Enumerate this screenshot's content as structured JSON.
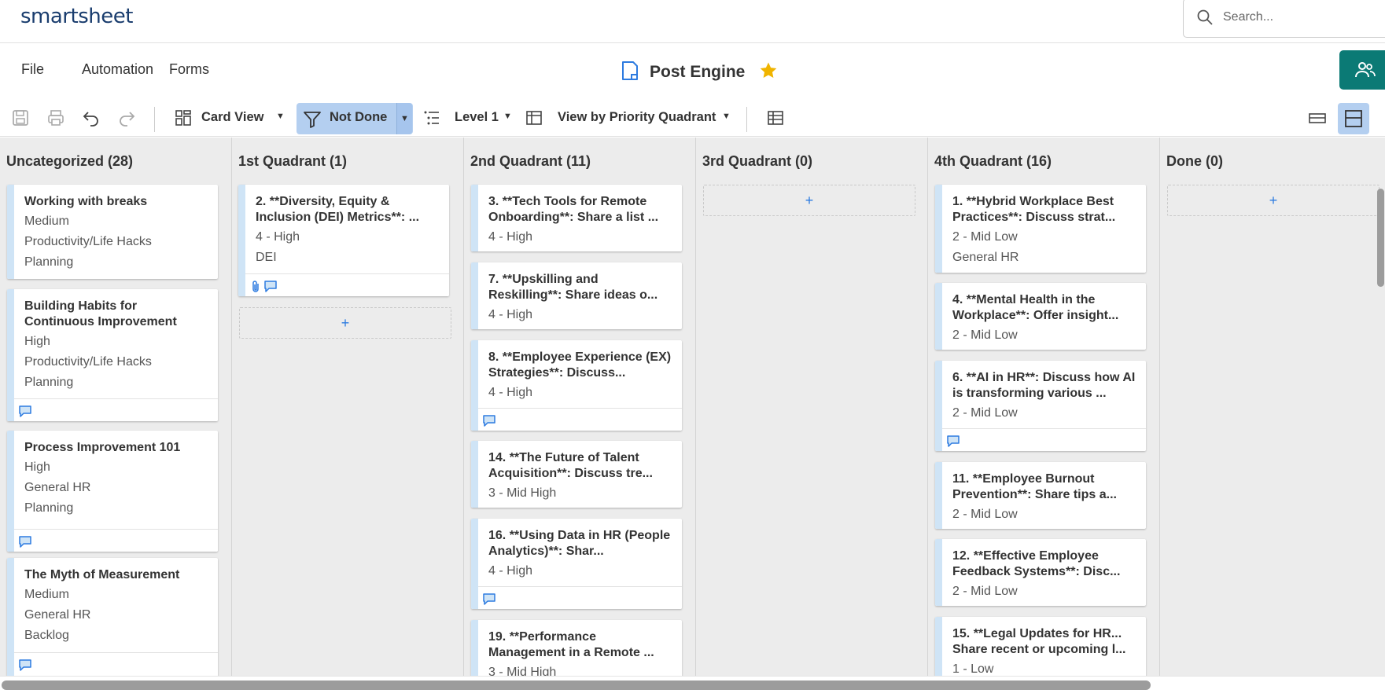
{
  "app": {
    "logo": "smartsheet"
  },
  "search": {
    "placeholder": "Search..."
  },
  "menu": {
    "file": "File",
    "automation": "Automation",
    "forms": "Forms"
  },
  "sheet": {
    "title": "Post Engine"
  },
  "toolbar": {
    "view_label": "Card View",
    "filter_label": "Not Done",
    "level_label": "Level 1",
    "view_by_label": "View by Priority Quadrant"
  },
  "lanes": [
    {
      "title": "Uncategorized (28)",
      "cards": [
        {
          "title": "Working with breaks",
          "fields": [
            "Medium",
            "Productivity/Life Hacks",
            "Planning"
          ]
        },
        {
          "title": "Building Habits for Continuous Improvement",
          "fields": [
            "High",
            "Productivity/Life Hacks",
            "Planning"
          ]
        },
        {
          "title": "Process Improvement 101",
          "fields": [
            "High",
            "General HR",
            "Planning"
          ]
        },
        {
          "title": "The Myth of Measurement",
          "fields": [
            "Medium",
            "General HR",
            "Backlog"
          ]
        }
      ]
    },
    {
      "title": "1st Quadrant (1)",
      "cards": [
        {
          "title": "2. **Diversity, Equity & Inclusion (DEI) Metrics**: ...",
          "fields": [
            "4 - High",
            "DEI"
          ]
        }
      ],
      "add": "+"
    },
    {
      "title": "2nd Quadrant (11)",
      "cards": [
        {
          "title": "3. **Tech Tools for Remote Onboarding**: Share a list ...",
          "fields": [
            "4 - High"
          ]
        },
        {
          "title": "7. **Upskilling and Reskilling**: Share ideas o...",
          "fields": [
            "4 - High"
          ]
        },
        {
          "title": "8. **Employee Experience (EX) Strategies**: Discuss...",
          "fields": [
            "4 - High"
          ]
        },
        {
          "title": "14. **The Future of Talent Acquisition**: Discuss tre...",
          "fields": [
            "3 - Mid High"
          ]
        },
        {
          "title": "16. **Using Data in HR (People Analytics)**: Shar...",
          "fields": [
            "4 - High"
          ]
        },
        {
          "title": "19. **Performance Management in a Remote ...",
          "fields": [
            "3 - Mid High"
          ]
        }
      ]
    },
    {
      "title": "3rd Quadrant (0)",
      "cards": [],
      "add": "+"
    },
    {
      "title": "4th Quadrant (16)",
      "cards": [
        {
          "title": "1. **Hybrid Workplace Best Practices**: Discuss strat...",
          "fields": [
            "2 - Mid Low",
            "General HR"
          ]
        },
        {
          "title": "4. **Mental Health in the Workplace**: Offer insight...",
          "fields": [
            "2 - Mid Low"
          ]
        },
        {
          "title": "6. **AI in HR**: Discuss how AI is transforming various ...",
          "fields": [
            "2 - Mid Low"
          ]
        },
        {
          "title": "11. **Employee Burnout Prevention**: Share tips a...",
          "fields": [
            "2 - Mid Low"
          ]
        },
        {
          "title": "12. **Effective Employee Feedback Systems**: Disc...",
          "fields": [
            "2 - Mid Low"
          ]
        },
        {
          "title": "15. **Legal Updates for HR... Share recent or upcoming l...",
          "fields": [
            "1 - Low"
          ]
        }
      ]
    },
    {
      "title": "Done (0)",
      "cards": [],
      "add": "+"
    }
  ],
  "colors": {
    "accent": "#2d7be0",
    "share_button": "#0b7a75",
    "star": "#f0b400",
    "card_bar": "#cfe4f6",
    "active_button": "#b4cff0"
  },
  "icons": {
    "comment": "comment-icon",
    "attachment": "attachment-icon",
    "star": "star-icon",
    "sheet": "sheet-icon"
  }
}
